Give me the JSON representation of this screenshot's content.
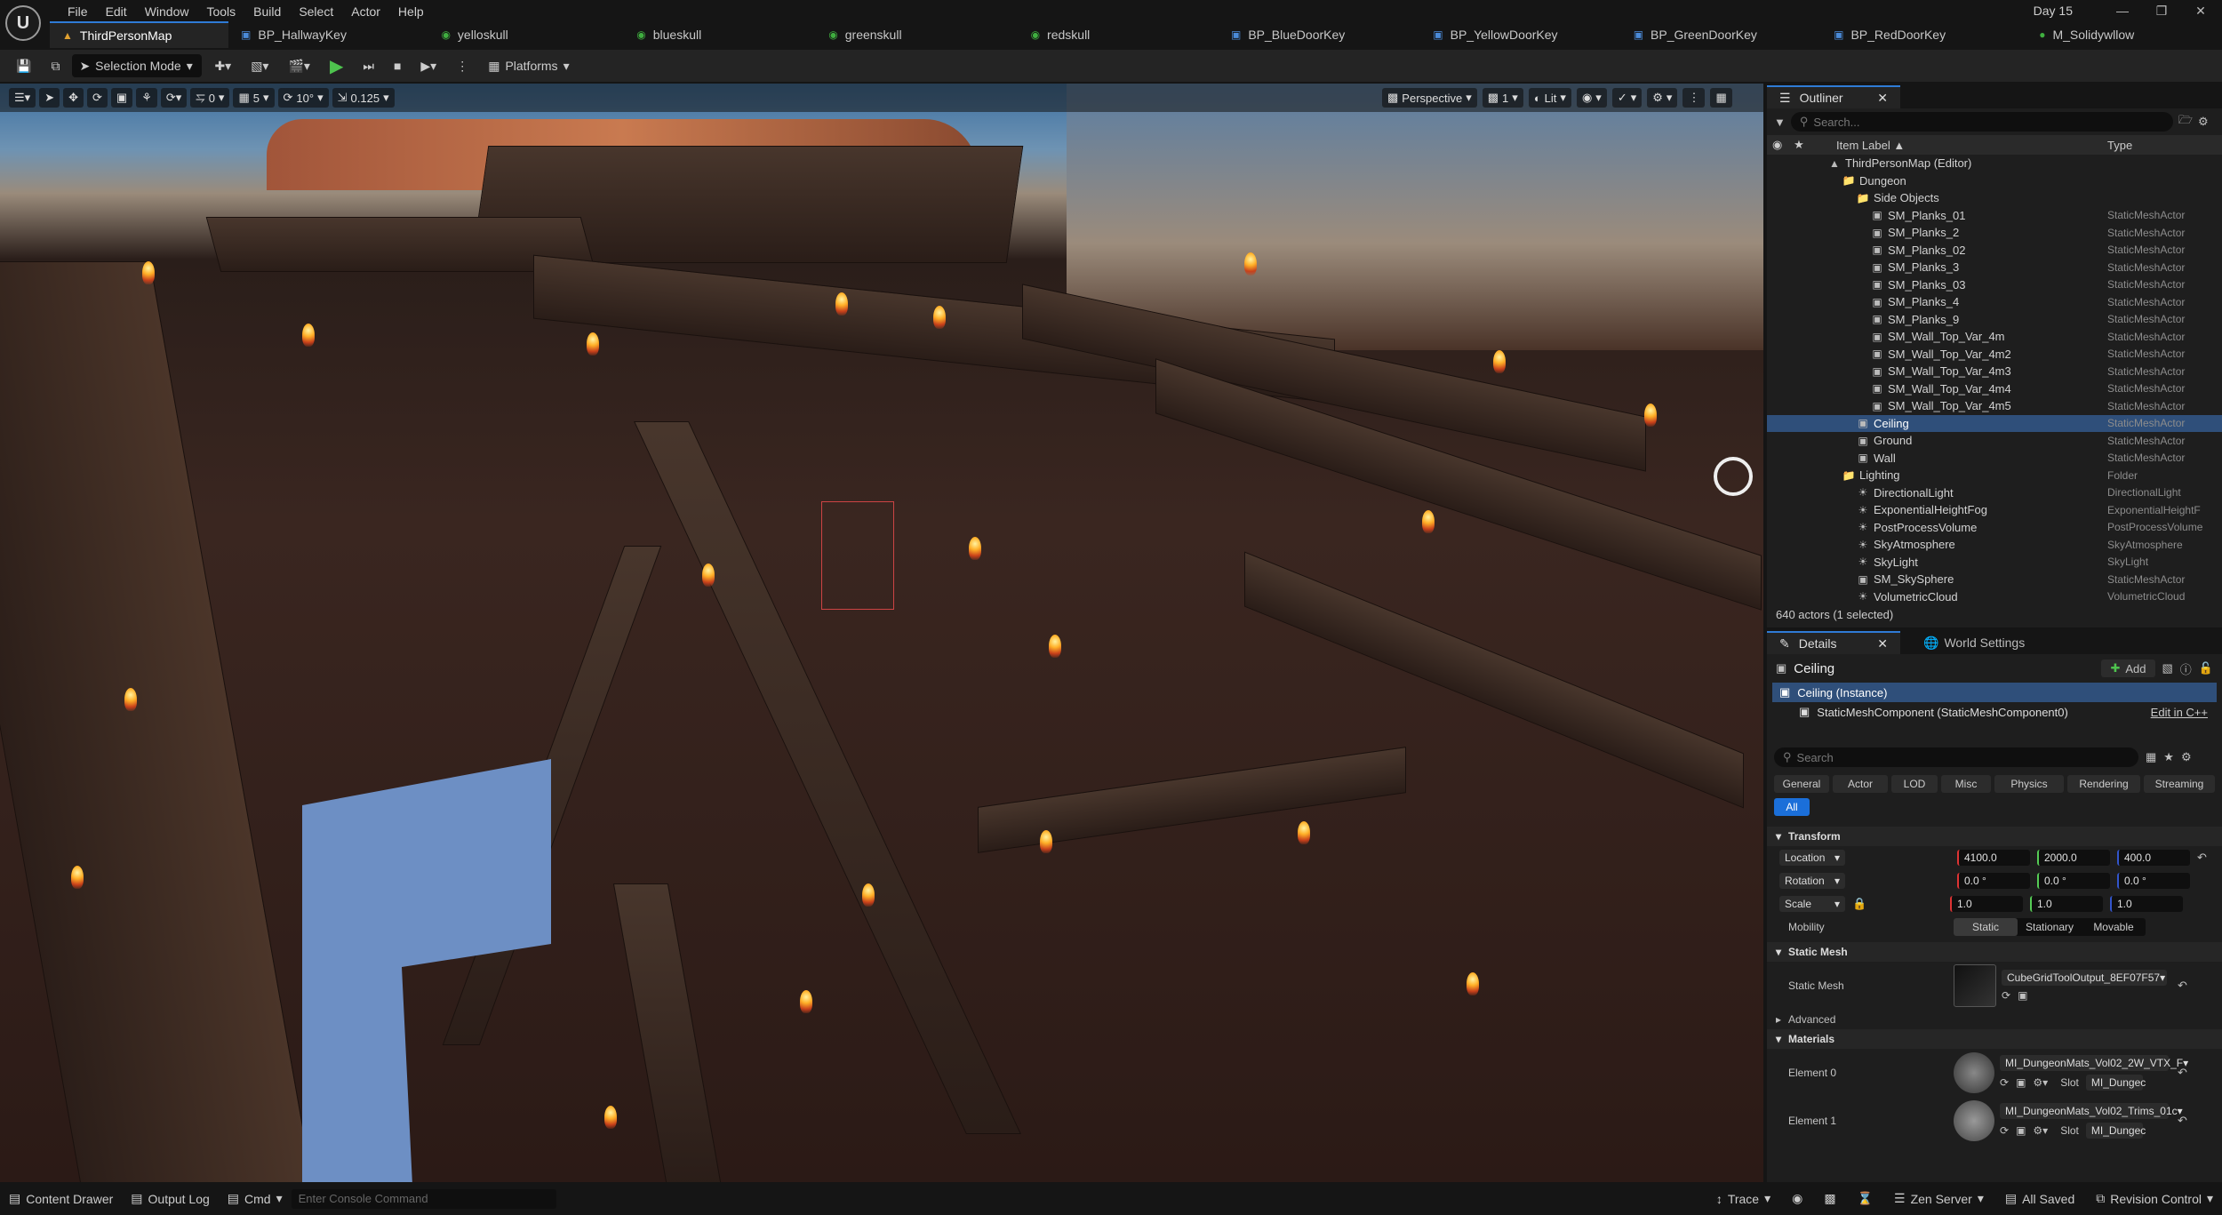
{
  "menu": [
    "File",
    "Edit",
    "Window",
    "Tools",
    "Build",
    "Select",
    "Actor",
    "Help"
  ],
  "project_name": "Day 15",
  "tabs": [
    {
      "label": "ThirdPersonMap",
      "icon": "level-icon"
    },
    {
      "label": "BP_HallwayKey",
      "icon": "blueprint-icon"
    },
    {
      "label": "yelloskull",
      "icon": "mesh-icon"
    },
    {
      "label": "blueskull",
      "icon": "mesh-icon"
    },
    {
      "label": "greenskull",
      "icon": "mesh-icon"
    },
    {
      "label": "redskull",
      "icon": "mesh-icon"
    },
    {
      "label": "BP_BlueDoorKey",
      "icon": "blueprint-icon"
    },
    {
      "label": "BP_YellowDoorKey",
      "icon": "blueprint-icon"
    },
    {
      "label": "BP_GreenDoorKey",
      "icon": "blueprint-icon"
    },
    {
      "label": "BP_RedDoorKey",
      "icon": "blueprint-icon"
    },
    {
      "label": "M_Solidywllow",
      "icon": "material-icon"
    }
  ],
  "toolbar": {
    "selection_mode": "Selection Mode",
    "platforms": "Platforms"
  },
  "viewport": {
    "snap_translate": "0",
    "snap_translate_grid": "5",
    "snap_rotate": "10°",
    "snap_scale": "0.125",
    "perspective": "Perspective",
    "lit": "Lit",
    "speed": "1"
  },
  "outliner": {
    "title": "Outliner",
    "search_placeholder": "Search...",
    "col_label": "Item Label ▲",
    "col_type": "Type",
    "rows": [
      {
        "label": "ThirdPersonMap (Editor)",
        "type": "",
        "depth": 0,
        "kind": "level"
      },
      {
        "label": "Dungeon",
        "type": "",
        "depth": 1,
        "kind": "folder"
      },
      {
        "label": "Side Objects",
        "type": "",
        "depth": 2,
        "kind": "folder"
      },
      {
        "label": "SM_Planks_01",
        "type": "StaticMeshActor",
        "depth": 3,
        "kind": "mesh"
      },
      {
        "label": "SM_Planks_2",
        "type": "StaticMeshActor",
        "depth": 3,
        "kind": "mesh"
      },
      {
        "label": "SM_Planks_02",
        "type": "StaticMeshActor",
        "depth": 3,
        "kind": "mesh"
      },
      {
        "label": "SM_Planks_3",
        "type": "StaticMeshActor",
        "depth": 3,
        "kind": "mesh"
      },
      {
        "label": "SM_Planks_03",
        "type": "StaticMeshActor",
        "depth": 3,
        "kind": "mesh"
      },
      {
        "label": "SM_Planks_4",
        "type": "StaticMeshActor",
        "depth": 3,
        "kind": "mesh"
      },
      {
        "label": "SM_Planks_9",
        "type": "StaticMeshActor",
        "depth": 3,
        "kind": "mesh"
      },
      {
        "label": "SM_Wall_Top_Var_4m",
        "type": "StaticMeshActor",
        "depth": 3,
        "kind": "mesh"
      },
      {
        "label": "SM_Wall_Top_Var_4m2",
        "type": "StaticMeshActor",
        "depth": 3,
        "kind": "mesh"
      },
      {
        "label": "SM_Wall_Top_Var_4m3",
        "type": "StaticMeshActor",
        "depth": 3,
        "kind": "mesh"
      },
      {
        "label": "SM_Wall_Top_Var_4m4",
        "type": "StaticMeshActor",
        "depth": 3,
        "kind": "mesh"
      },
      {
        "label": "SM_Wall_Top_Var_4m5",
        "type": "StaticMeshActor",
        "depth": 3,
        "kind": "mesh"
      },
      {
        "label": "Ceiling",
        "type": "StaticMeshActor",
        "depth": 2,
        "kind": "mesh",
        "selected": true
      },
      {
        "label": "Ground",
        "type": "StaticMeshActor",
        "depth": 2,
        "kind": "mesh"
      },
      {
        "label": "Wall",
        "type": "StaticMeshActor",
        "depth": 2,
        "kind": "mesh"
      },
      {
        "label": "Lighting",
        "type": "Folder",
        "depth": 1,
        "kind": "folder"
      },
      {
        "label": "DirectionalLight",
        "type": "DirectionalLight",
        "depth": 2,
        "kind": "light"
      },
      {
        "label": "ExponentialHeightFog",
        "type": "ExponentialHeightF",
        "depth": 2,
        "kind": "light"
      },
      {
        "label": "PostProcessVolume",
        "type": "PostProcessVolume",
        "depth": 2,
        "kind": "light"
      },
      {
        "label": "SkyAtmosphere",
        "type": "SkyAtmosphere",
        "depth": 2,
        "kind": "light"
      },
      {
        "label": "SkyLight",
        "type": "SkyLight",
        "depth": 2,
        "kind": "light"
      },
      {
        "label": "SM_SkySphere",
        "type": "StaticMeshActor",
        "depth": 2,
        "kind": "mesh"
      },
      {
        "label": "VolumetricCloud",
        "type": "VolumetricCloud",
        "depth": 2,
        "kind": "light"
      }
    ],
    "footer": "640 actors (1 selected)"
  },
  "details": {
    "tab": "Details",
    "world_tab": "World Settings",
    "actor_name": "Ceiling",
    "add_label": "Add",
    "instance": "Ceiling (Instance)",
    "component": "StaticMeshComponent (StaticMeshComponent0)",
    "edit_cpp": "Edit in C++",
    "search_placeholder": "Search",
    "categories": [
      "General",
      "Actor",
      "LOD",
      "Misc",
      "Physics",
      "Rendering",
      "Streaming"
    ],
    "all": "All",
    "transform": {
      "title": "Transform",
      "location": {
        "label": "Location",
        "x": "4100.0",
        "y": "2000.0",
        "z": "400.0"
      },
      "rotation": {
        "label": "Rotation",
        "x": "0.0 °",
        "y": "0.0 °",
        "z": "0.0 °"
      },
      "scale": {
        "label": "Scale",
        "x": "1.0",
        "y": "1.0",
        "z": "1.0"
      },
      "mobility": "Mobility",
      "mob_static": "Static",
      "mob_stationary": "Stationary",
      "mob_movable": "Movable"
    },
    "static_mesh": {
      "title": "Static Mesh",
      "label": "Static Mesh",
      "value": "CubeGridToolOutput_8EF07F57"
    },
    "advanced": "Advanced",
    "materials": {
      "title": "Materials",
      "e0": {
        "label": "Element 0",
        "value": "MI_DungeonMats_Vol02_2W_VTX_F",
        "slot": "Slot",
        "slot_val": "MI_Dungec"
      },
      "e1": {
        "label": "Element 1",
        "value": "MI_DungeonMats_Vol02_Trims_01c",
        "slot": "Slot",
        "slot_val": "MI_Dungec"
      }
    }
  },
  "status": {
    "content_drawer": "Content Drawer",
    "output_log": "Output Log",
    "cmd": "Cmd",
    "console_placeholder": "Enter Console Command",
    "trace": "Trace",
    "zen": "Zen Server",
    "saved": "All Saved",
    "revision": "Revision Control"
  }
}
